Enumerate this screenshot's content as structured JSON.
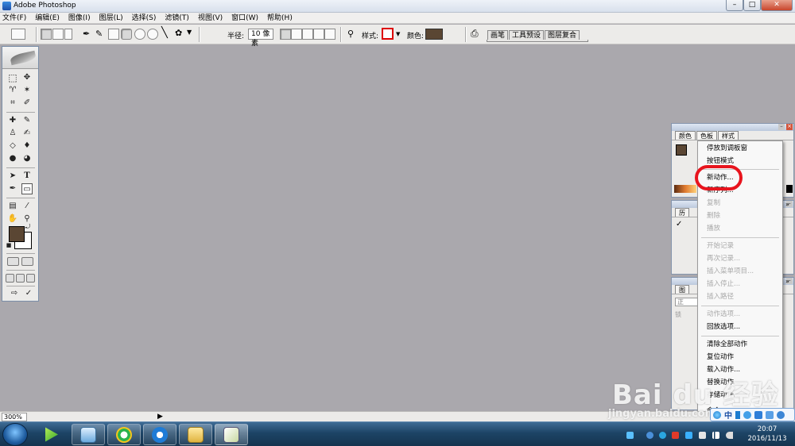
{
  "window": {
    "title": "Adobe Photoshop",
    "controls": {
      "minimize": "–",
      "maximize": "□",
      "close": "✕"
    }
  },
  "menubar": {
    "items": [
      "文件(F)",
      "编辑(E)",
      "图像(I)",
      "图层(L)",
      "选择(S)",
      "滤镜(T)",
      "视图(V)",
      "窗口(W)",
      "帮助(H)"
    ]
  },
  "options_bar": {
    "radius_label": "半径:",
    "radius_value": "10 像素",
    "style_label": "样式:",
    "color_label": "颜色:",
    "color_value": "#5a4633",
    "brush_tabs": [
      "画笔",
      "工具预设",
      "图层复合"
    ]
  },
  "toolbox": {
    "tools": [
      "marquee-tool",
      "move-tool",
      "lasso-tool",
      "magic-wand-tool",
      "crop-tool",
      "slice-tool",
      "healing-brush-tool",
      "brush-tool",
      "clone-stamp-tool",
      "history-brush-tool",
      "eraser-tool",
      "paint-bucket-tool",
      "blur-tool",
      "dodge-tool",
      "path-selection-tool",
      "type-tool",
      "pen-tool",
      "rectangle-tool",
      "notes-tool",
      "eyedropper-tool",
      "hand-tool",
      "zoom-tool"
    ],
    "type_tool_glyph": "T",
    "foreground_color": "#5a4633",
    "background_color": "#ffffff"
  },
  "panels": {
    "color_panel_tabs": [
      "颜色",
      "色板",
      "样式"
    ],
    "history_panel_tab": "历",
    "layers_panel_tab": "图",
    "layers_blend_mode": "正",
    "layers_lock": "锁"
  },
  "actions_menu": {
    "items": [
      {
        "label": "停放到调板窗",
        "enabled": true
      },
      {
        "label": "按钮模式",
        "enabled": true
      },
      {
        "label": "新动作...",
        "enabled": true
      },
      {
        "label": "新序列...",
        "enabled": true
      },
      {
        "label": "复制",
        "enabled": false
      },
      {
        "label": "删除",
        "enabled": false
      },
      {
        "label": "播放",
        "enabled": false
      },
      {
        "label": "开始记录",
        "enabled": false
      },
      {
        "label": "再次记录...",
        "enabled": false
      },
      {
        "label": "插入菜单项目...",
        "enabled": false
      },
      {
        "label": "插入停止...",
        "enabled": false
      },
      {
        "label": "插入路径",
        "enabled": false
      },
      {
        "label": "动作选项...",
        "enabled": false
      },
      {
        "label": "回放选项...",
        "enabled": true
      },
      {
        "label": "清除全部动作",
        "enabled": true
      },
      {
        "label": "复位动作",
        "enabled": true
      },
      {
        "label": "载入动作...",
        "enabled": true
      },
      {
        "label": "替换动作...",
        "enabled": true
      },
      {
        "label": "存储动作...",
        "enabled": true
      },
      {
        "label": "命令",
        "enabled": true
      }
    ],
    "highlighted": "新动作..."
  },
  "statusbar": {
    "zoom": "300%",
    "arrow": "▶"
  },
  "taskbar": {
    "apps": [
      "media-player",
      "explorer-window",
      "browser-360",
      "internet-explorer",
      "file-manager",
      "photoshop"
    ],
    "ime": {
      "label": "中"
    },
    "clock": {
      "time": "20:07",
      "date": "2016/11/13"
    }
  },
  "watermark": {
    "brand": "Bai du 经验",
    "url": "jingyan.baidu.com"
  }
}
